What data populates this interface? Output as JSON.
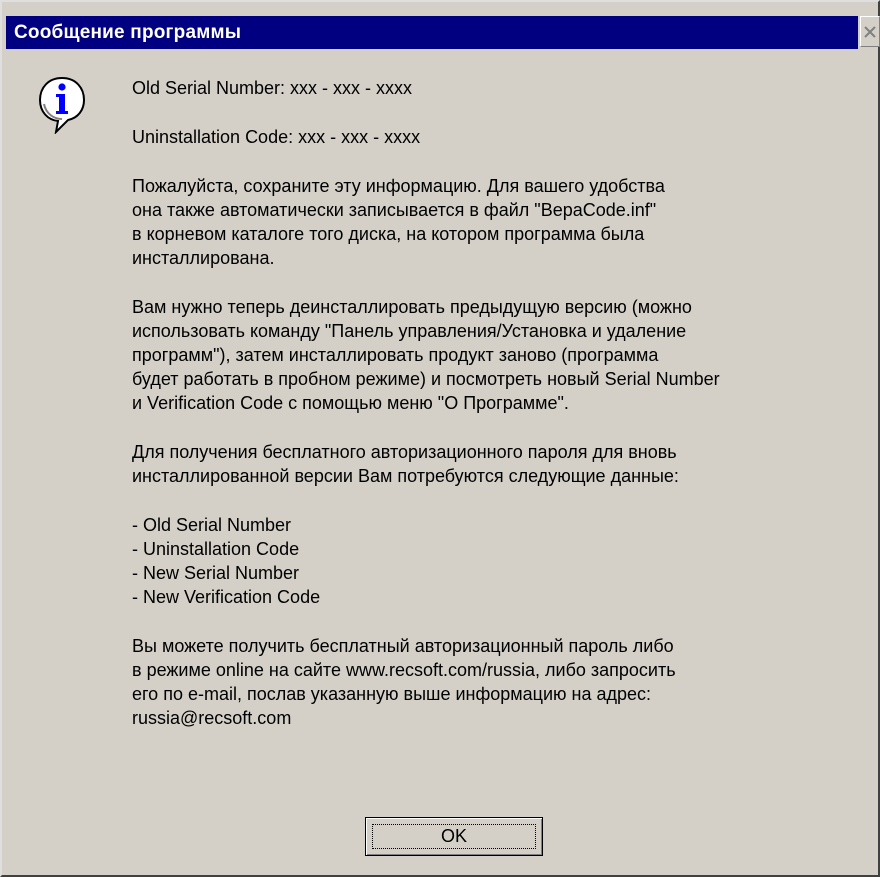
{
  "window": {
    "title": "Сообщение программы"
  },
  "icons": {
    "info": "info-icon",
    "close": "close-icon"
  },
  "message": {
    "serial_line": "Old  Serial Number:   xxx - xxx - xxxx",
    "uninstall_line": "Uninstallation Code:  xxx - xxx - xxxx",
    "para1": [
      "Пожалуйста, сохраните эту информацию.  Для вашего удобства",
      "она также автоматически записывается в файл  \"BepaCode.inf\"",
      "в корневом каталоге того  диска, на котором программа была",
      "инсталлирована."
    ],
    "para2": [
      "Вам нужно теперь деинсталлировать предыдущую версию (можно",
      "использовать команду \"Панель управления/Установка и удаление",
      "программ\"), затем инсталлировать продукт заново (программа",
      "будет работать в пробном режиме) и посмотреть новый Serial Number",
      "и Verification Code с помощью меню \"О Программе\"."
    ],
    "para3": [
      "Для получения бесплатного авторизационного пароля для вновь",
      "инсталлированной версии Вам потребуются следующие данные:"
    ],
    "list": [
      "- Old Serial Number",
      "- Uninstallation Code",
      "- New Serial Number",
      "- New Verification Code"
    ],
    "para4": [
      "Вы можете получить бесплатный авторизационный пароль либо",
      "в режиме online на сайте www.recsoft.com/russia, либо запросить",
      "его по e-mail, послав указанную выше информацию на адрес:",
      "russia@recsoft.com"
    ]
  },
  "buttons": {
    "ok_label": "OK"
  },
  "colors": {
    "title_bar": "#000080",
    "face": "#d4d0c8",
    "icon_blue": "#0000ff"
  }
}
